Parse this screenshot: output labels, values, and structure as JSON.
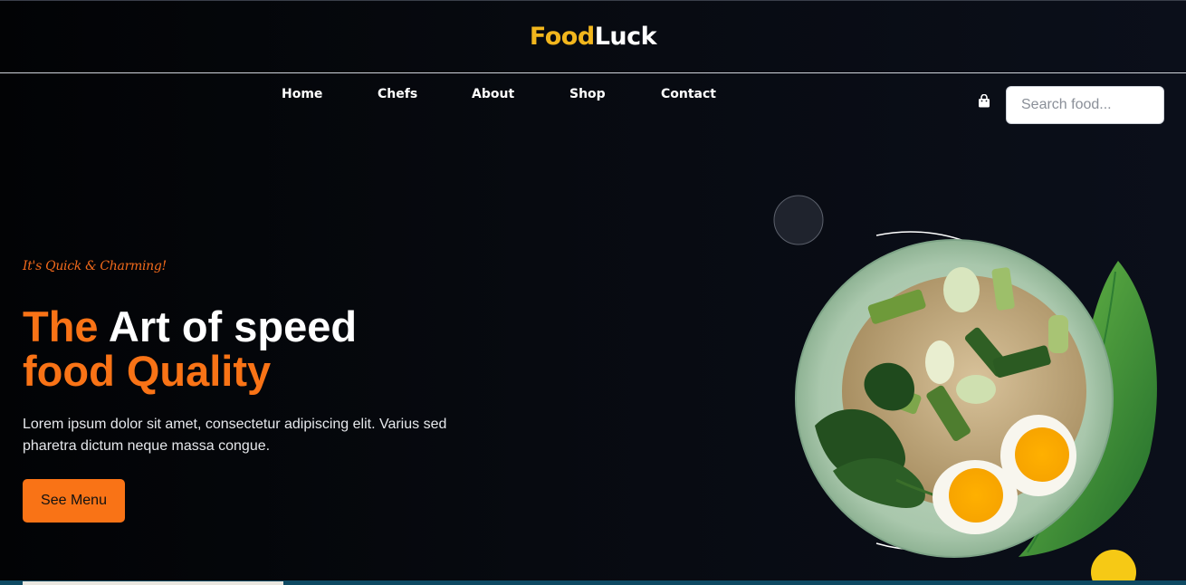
{
  "brand": {
    "part1": "Food",
    "part2": "Luck"
  },
  "nav": {
    "items": [
      "Home",
      "Chefs",
      "About",
      "Shop",
      "Contact"
    ]
  },
  "header": {
    "cart_icon": "shopping-bag-icon"
  },
  "search": {
    "placeholder": "Search food..."
  },
  "hero": {
    "tagline": "It's Quick & Charming!",
    "headline": {
      "line1_accent": "The",
      "line1_rest": "Art of speed",
      "line2": "food Quality"
    },
    "description": "Lorem ipsum dolor sit amet, consectetur adipiscing elit. Varius sed pharetra dictum neque massa congue.",
    "cta_label": "See Menu"
  },
  "colors": {
    "accent_orange": "#f97316",
    "logo_yellow": "#f2b61d",
    "decor_yellow": "#f6c915",
    "background": "#070a10"
  }
}
